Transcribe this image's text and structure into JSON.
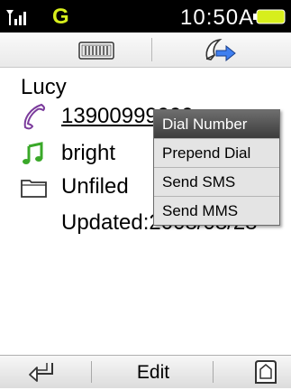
{
  "status_bar": {
    "network": "G",
    "time": "10:50AM"
  },
  "tabs": [
    {
      "icon": "contact-card-icon"
    },
    {
      "icon": "contact-transfer-icon"
    }
  ],
  "contact": {
    "name": "Lucy",
    "phone": "13900999999",
    "ringtone": "bright",
    "group": "Unfiled",
    "updated": "Updated:2008/08/28"
  },
  "context_menu": {
    "items": [
      "Dial Number",
      "Prepend Dial",
      "Send SMS",
      "Send MMS"
    ],
    "selected_index": 0
  },
  "bottom_bar": {
    "edit_label": "Edit"
  },
  "colors": {
    "network": "#d7ee1c",
    "battery": "#d7ee1c",
    "phone_icon": "#7b3b9c",
    "ring_icon": "#3aa829"
  }
}
